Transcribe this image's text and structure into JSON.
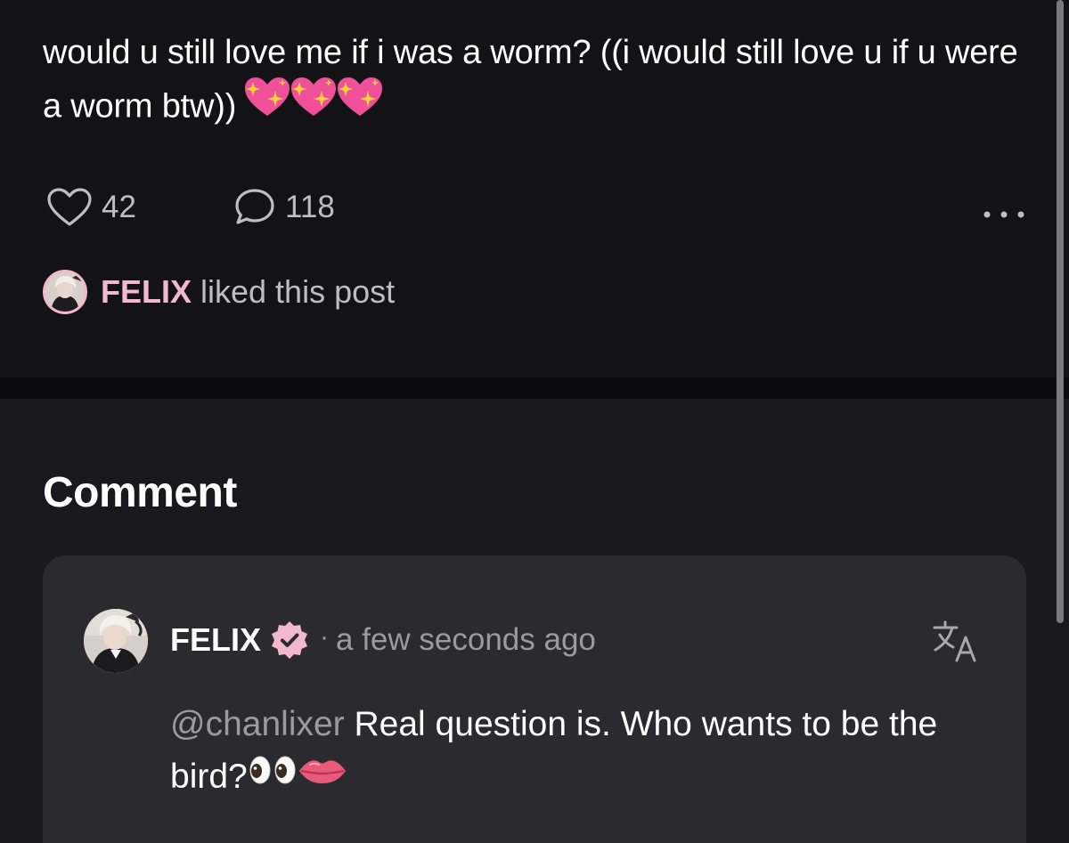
{
  "post": {
    "text": "would u still love me if i was a worm? ((i would still love u if u were a worm btw))",
    "emoji": [
      "sparkling-heart",
      "sparkling-heart",
      "sparkling-heart"
    ],
    "like_count": "42",
    "comment_count": "118",
    "liked_by": {
      "name": "FELIX",
      "text": "liked this post"
    }
  },
  "comment_section": {
    "heading": "Comment",
    "comment": {
      "author": "FELIX",
      "verified": true,
      "separator": "·",
      "time": "a few seconds ago",
      "mention": "@chanlixer",
      "text": "Real question is. Who wants to be the bird?",
      "emoji": [
        "eyes",
        "lips"
      ]
    }
  },
  "icons": {
    "like": "heart-outline-icon",
    "comment": "speech-bubble-icon",
    "more": "more-dots-icon",
    "translate": "translate-icon",
    "verified": "verified-badge-icon"
  },
  "colors": {
    "background": "#131316",
    "comment_section_bg": "#19191d",
    "card_bg": "#2a2a2f",
    "accent_pink": "#f2b8cc",
    "muted_text": "#9a9aa0"
  }
}
